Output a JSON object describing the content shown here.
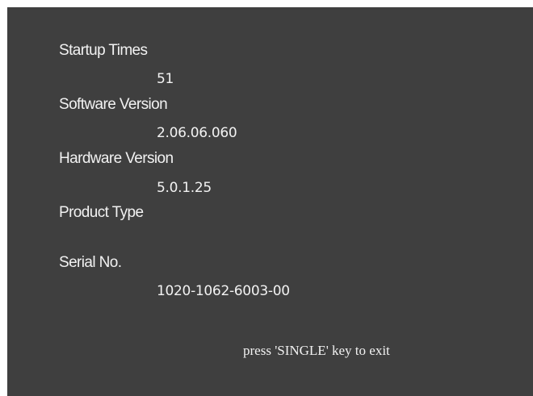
{
  "info_screen": {
    "startup_times_label": "Startup Times",
    "startup_times_value": "51",
    "software_version_label": "Software Version",
    "software_version_value": "2.06.06.060",
    "hardware_version_label": "Hardware Version",
    "hardware_version_value": "5.0.1.25",
    "product_type_label": "Product Type",
    "product_type_value": "",
    "serial_no_label": "Serial No.",
    "serial_no_value": "1020-1062-6003-00",
    "exit_hint": "press 'SINGLE' key to exit"
  },
  "colors": {
    "background": "#3f3f3f",
    "text": "#f2f2f2",
    "frame": "#ffffff"
  }
}
